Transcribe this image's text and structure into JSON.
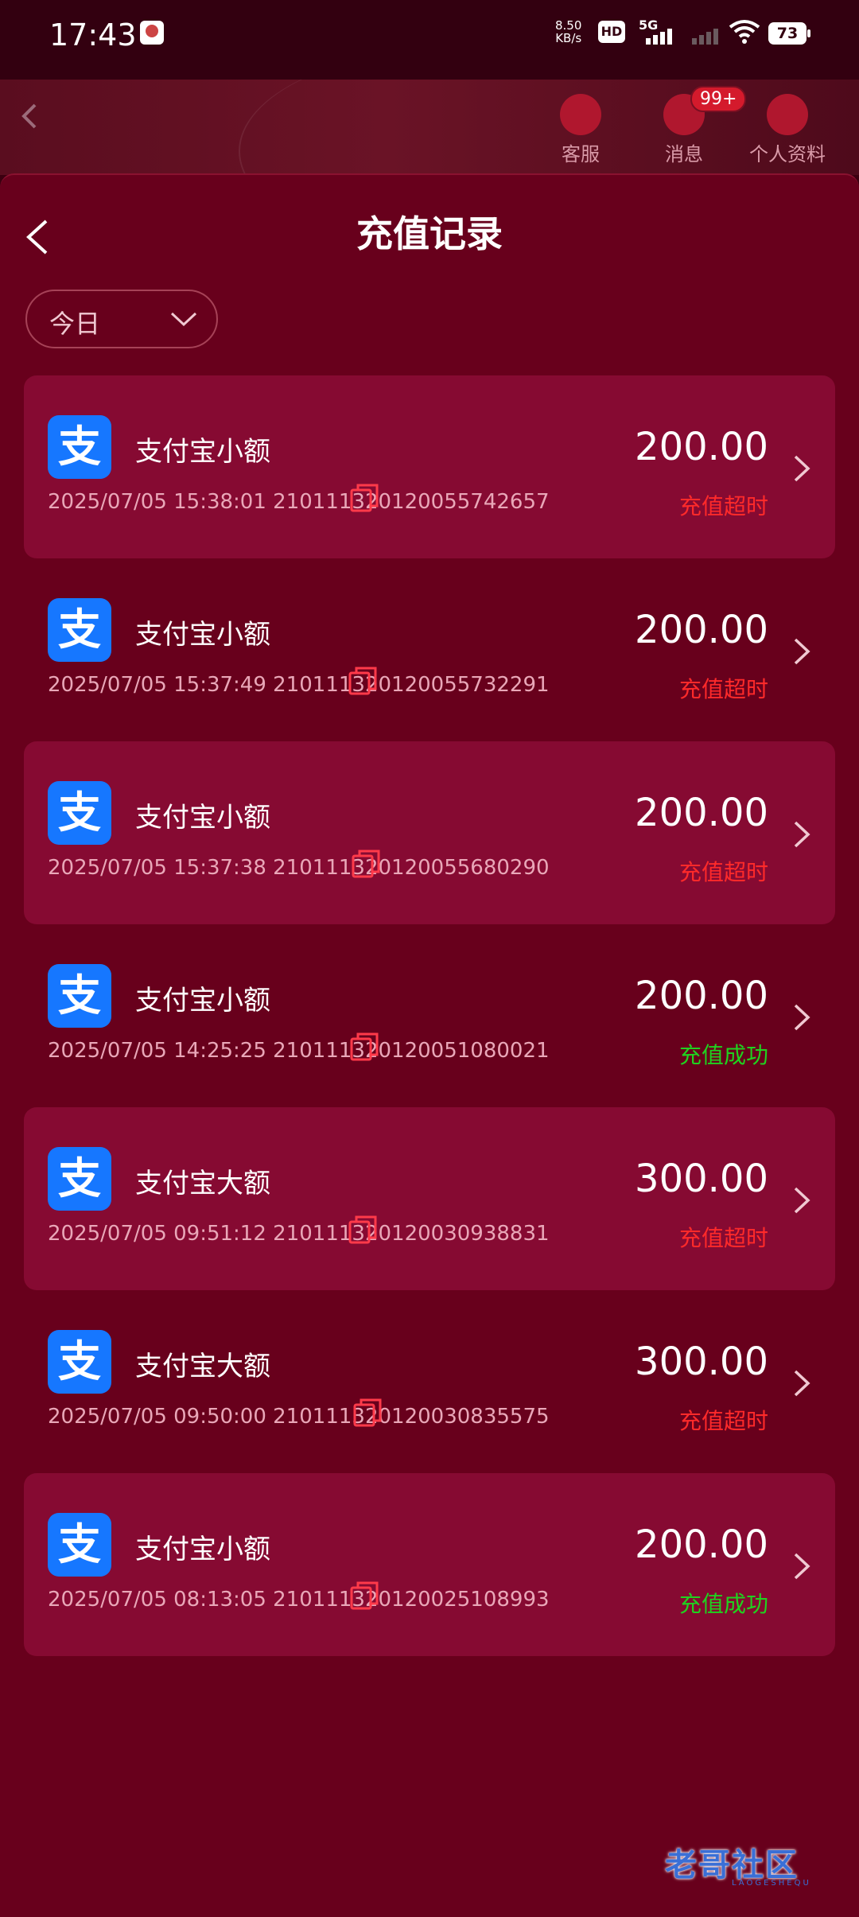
{
  "status_bar": {
    "time": "17:43",
    "speed_value": "8.50",
    "speed_unit": "KB/s",
    "hd": "HD",
    "network": "5G",
    "battery": "73"
  },
  "app_nav": {
    "service": "客服",
    "messages": "消息",
    "message_badge": "99+",
    "profile": "个人资料"
  },
  "page": {
    "title": "充值记录",
    "filter_label": "今日"
  },
  "records": [
    {
      "method": "支付宝小额",
      "datetime": "2025/07/05 15:38:01",
      "order_id": "21011132012005574265​7",
      "amount": "200.00",
      "status": "充值超时",
      "status_type": "fail"
    },
    {
      "method": "支付宝小额",
      "datetime": "2025/07/05 15:37:49",
      "order_id": "210111320120055732291",
      "amount": "200.00",
      "status": "充值超时",
      "status_type": "fail"
    },
    {
      "method": "支付宝小额",
      "datetime": "2025/07/05 15:37:38",
      "order_id": "210111320120055680290",
      "amount": "200.00",
      "status": "充值超时",
      "status_type": "fail"
    },
    {
      "method": "支付宝小额",
      "datetime": "2025/07/05 14:25:25",
      "order_id": "210111320120051080021",
      "amount": "200.00",
      "status": "充值成功",
      "status_type": "ok"
    },
    {
      "method": "支付宝大额",
      "datetime": "2025/07/05 09:51:12",
      "order_id": "210111320120030938831",
      "amount": "300.00",
      "status": "充值超时",
      "status_type": "fail"
    },
    {
      "method": "支付宝大额",
      "datetime": "2025/07/05 09:50:00",
      "order_id": "210111320120030835575",
      "amount": "300.00",
      "status": "充值超时",
      "status_type": "fail"
    },
    {
      "method": "支付宝小额",
      "datetime": "2025/07/05 08:13:05",
      "order_id": "210111320120025108993",
      "amount": "200.00",
      "status": "充值成功",
      "status_type": "ok"
    }
  ],
  "alipay_glyph": "支",
  "watermark": "老哥社区",
  "watermark_sub": "LAOGESHEQU",
  "colors": {
    "background": "#68001c",
    "card_alt": "#860a32",
    "status_fail": "#ff2a2a",
    "status_ok": "#1fd31f",
    "alipay_blue": "#1677ff"
  },
  "icons": {
    "back": "chevron-left-icon",
    "copy": "copy-icon",
    "row_arrow": "chevron-right-icon",
    "filter": "chevron-down-icon"
  }
}
